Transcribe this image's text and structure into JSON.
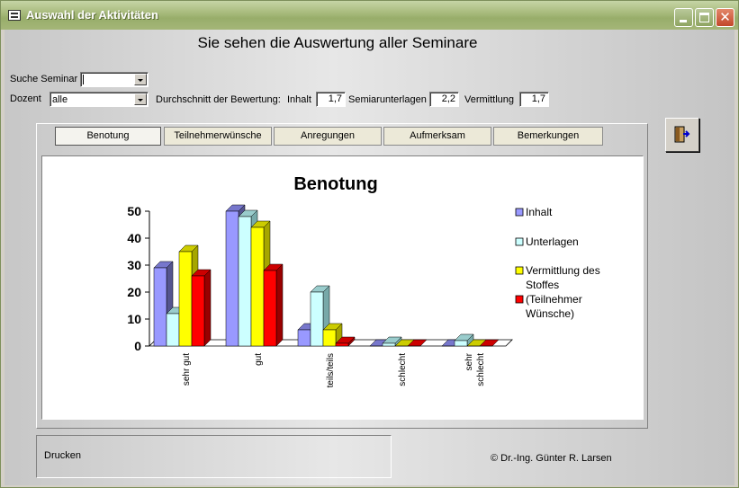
{
  "window": {
    "title": "Auswahl der Aktivitäten"
  },
  "heading": "Sie sehen die Auswertung aller Seminare",
  "filters": {
    "seminar_label": "Suche Seminar",
    "seminar_value": "",
    "dozent_label": "Dozent",
    "dozent_value": "alle"
  },
  "averages": {
    "label": "Durchschnitt der Bewertung:",
    "inhalt_label": "Inhalt",
    "inhalt_value": "1,7",
    "unterlagen_label": "Semiarunterlagen",
    "unterlagen_value": "2,2",
    "vermittlung_label": "Vermittlung",
    "vermittlung_value": "1,7"
  },
  "tabs": [
    {
      "label": "Benotung",
      "active": true
    },
    {
      "label": "Teilnehmerwünsche",
      "active": false
    },
    {
      "label": "Anregungen",
      "active": false
    },
    {
      "label": "Aufmerksam",
      "active": false
    },
    {
      "label": "Bemerkungen",
      "active": false
    }
  ],
  "print_label": "Drucken",
  "copyright": "© Dr.-Ing. Günter R. Larsen",
  "chart_data": {
    "type": "bar",
    "title": "Benotung",
    "categories": [
      "sehr gut",
      "gut",
      "teils/teils",
      "schlecht",
      "sehr schlecht"
    ],
    "category_lines": [
      [
        "sehr gut"
      ],
      [
        "gut"
      ],
      [
        "teils/teils"
      ],
      [
        "schlecht"
      ],
      [
        "sehr",
        "schlecht"
      ]
    ],
    "series": [
      {
        "name": "Inhalt",
        "values": [
          29,
          50,
          6,
          0,
          0
        ]
      },
      {
        "name": "Unterlagen",
        "values": [
          12,
          48,
          20,
          1,
          2
        ]
      },
      {
        "name": "Vermittlung des Stoffes",
        "values": [
          35,
          44,
          6,
          0,
          0
        ]
      },
      {
        "name": "(Teilnehmer Wünsche)",
        "values": [
          26,
          28,
          1,
          0,
          0
        ]
      }
    ],
    "legend_lines": [
      [
        "Inhalt"
      ],
      [
        "Unterlagen"
      ],
      [
        "Vermittlung des",
        "Stoffes"
      ],
      [
        "(Teilnehmer",
        "Wünsche)"
      ]
    ],
    "colors": [
      "#9999ff",
      "#ccffff",
      "#ffff00",
      "#ff0000"
    ],
    "side_colors": [
      "#55558f",
      "#77a9a9",
      "#a6a600",
      "#990000"
    ],
    "top_colors": [
      "#7777cc",
      "#99cccc",
      "#cccc00",
      "#cc0000"
    ],
    "yticks": [
      0,
      10,
      20,
      30,
      40,
      50
    ],
    "ylim": [
      0,
      50
    ],
    "three_d": true,
    "legend_position": "right"
  }
}
